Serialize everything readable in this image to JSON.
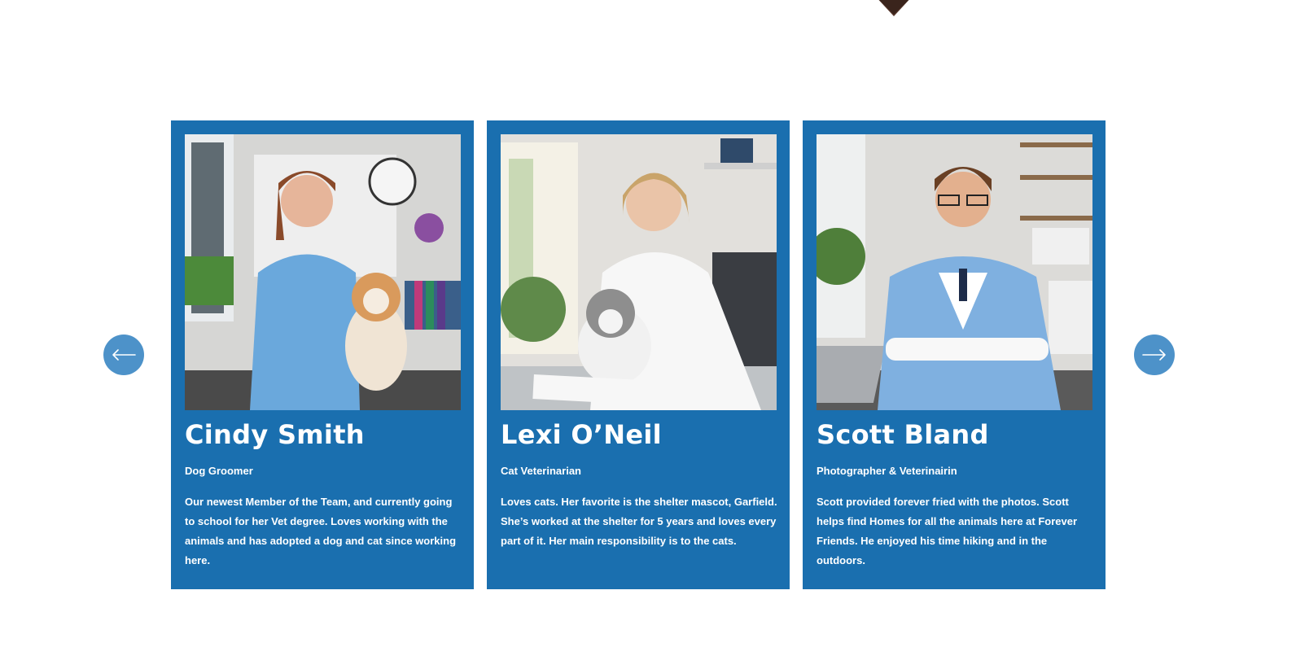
{
  "carousel": {
    "prev_icon": "arrow-left-icon",
    "next_icon": "arrow-right-icon",
    "accent_color": "#1a6faf",
    "arrow_color": "#4d92c9",
    "cards": [
      {
        "photo": "Veterinarian in blue scrubs with a small dog",
        "name": "Cindy Smith",
        "role": "Dog Groomer",
        "bio": "Our newest Member of the Team,  and currently going to school for her Vet degree. Loves working with the animals and has adopted a dog and cat since working here."
      },
      {
        "photo": "Veterinarian in white coat holding a cat",
        "name": "Lexi O’Neil",
        "role": "Cat Veterinarian",
        "bio": "Loves cats. Her favorite is the shelter mascot, Garfield. She’s worked at the shelter for 5 years and loves every part of it. Her main responsibility is to the cats."
      },
      {
        "photo": "Veterinarian in blue scrubs at desk with laptop",
        "name": "Scott Bland",
        "role": "Photographer & Veterinairin",
        "bio": "Scott provided forever fried with the photos. Scott helps find Homes for all the animals here at Forever Friends. He enjoyed his time hiking and in the outdoors."
      }
    ]
  }
}
